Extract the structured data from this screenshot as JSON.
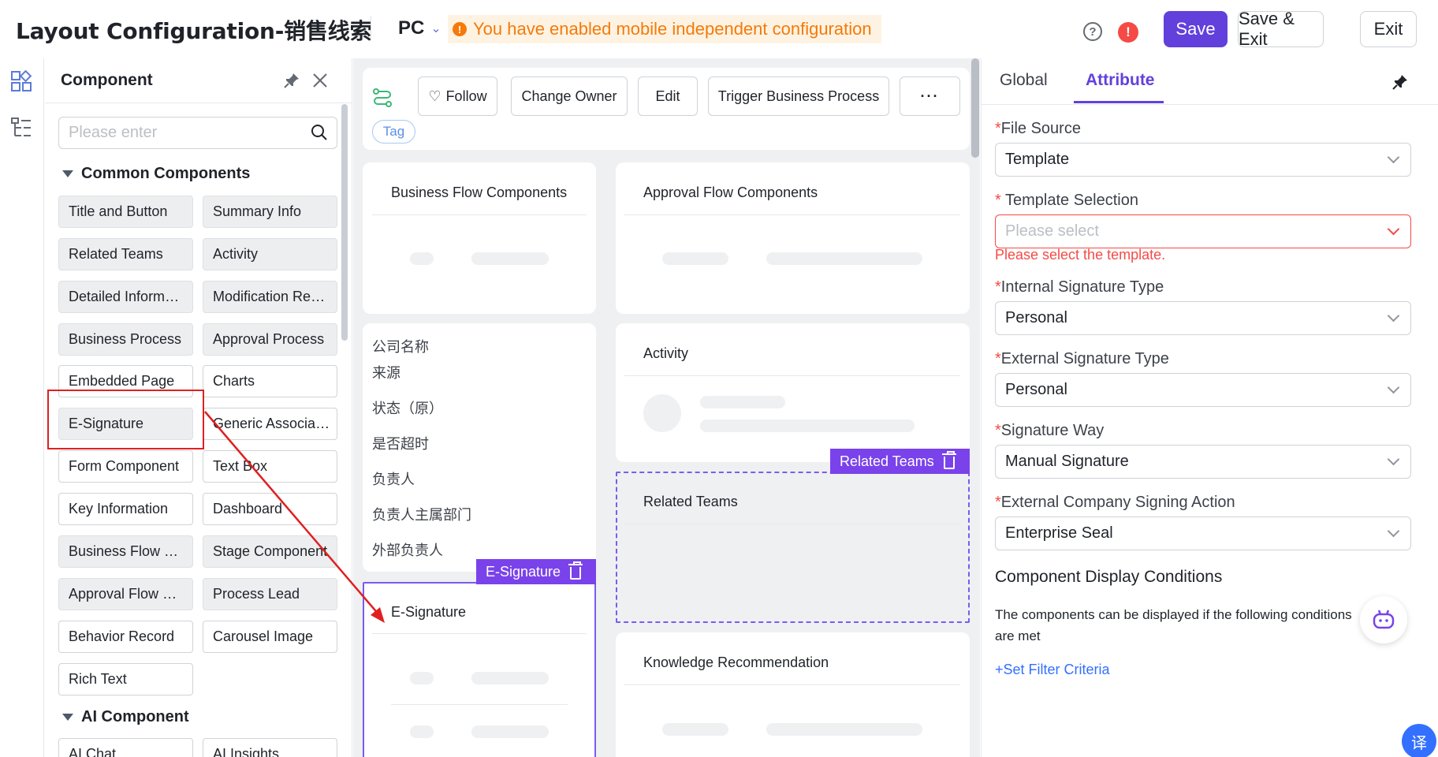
{
  "header": {
    "title": "Layout Configuration-销售线索",
    "device": "PC",
    "warning": "You have enabled mobile independent configuration",
    "save_label": "Save",
    "save_exit_label": "Save & Exit",
    "exit_label": "Exit"
  },
  "component_panel": {
    "title": "Component",
    "search_placeholder": "Please enter",
    "common_group": "Common Components",
    "ai_group": "AI Component",
    "items": [
      "Title and Button",
      "Summary Info",
      "Related Teams",
      "Activity",
      "Detailed Information",
      "Modification Record",
      "Business Process",
      "Approval Process",
      "Embedded Page",
      "Charts",
      "E-Signature",
      "Generic Association",
      "Form Component",
      "Text Box",
      "Key Information",
      "Dashboard",
      "Business Flow Components",
      "Stage Component",
      "Approval Flow Components",
      "Process Lead",
      "Behavior Record",
      "Carousel Image",
      "Rich Text"
    ],
    "ai_items": [
      "AI Chat",
      "AI Insights"
    ]
  },
  "canvas": {
    "toolbar": {
      "follow": "Follow",
      "change_owner": "Change Owner",
      "edit": "Edit",
      "trigger": "Trigger Business Process",
      "more": "···",
      "tag": "Tag"
    },
    "cards": {
      "business_flow": "Business Flow Components",
      "approval_flow": "Approval Flow Components",
      "activity": "Activity",
      "related_teams": "Related Teams",
      "esignature": "E-Signature",
      "knowledge": "Knowledge Recommendation"
    },
    "fields": [
      "公司名称",
      "来源",
      "状态（原）",
      "是否超时",
      "负责人",
      "负责人主属部门",
      "外部负责人"
    ],
    "related_tag": "Related Teams",
    "esig_tag": "E-Signature"
  },
  "right_panel": {
    "tab_global": "Global",
    "tab_attribute": "Attribute",
    "file_source_label": "File Source",
    "file_source_value": "Template",
    "template_selection_label": "Template Selection",
    "template_selection_placeholder": "Please select",
    "template_error": "Please select the template.",
    "internal_sig_label": "Internal Signature Type",
    "internal_sig_value": "Personal",
    "external_sig_label": "External Signature Type",
    "external_sig_value": "Personal",
    "sig_way_label": "Signature Way",
    "sig_way_value": "Manual Signature",
    "ext_company_label": "External Company Signing Action",
    "ext_company_value": "Enterprise Seal",
    "display_cond_title": "Component Display Conditions",
    "display_cond_desc": "The components can be displayed if the following conditions are met",
    "set_filter": "+Set Filter Criteria"
  },
  "colors": {
    "primary": "#6240dc",
    "tag_purple": "#7a42ea",
    "warning": "#f57a0a",
    "error": "#f54a45",
    "annotation_red": "#e02020"
  }
}
